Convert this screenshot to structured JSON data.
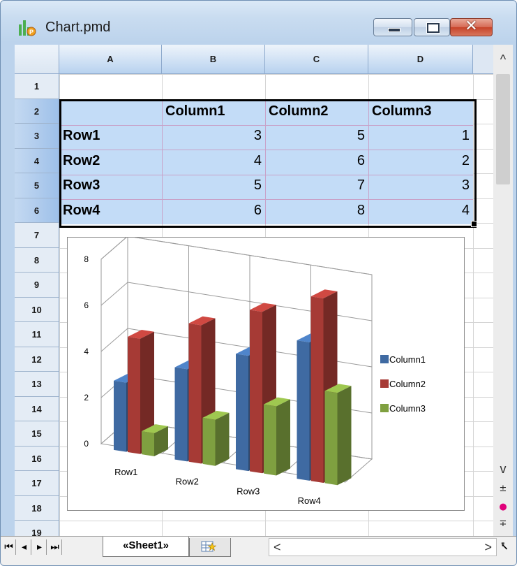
{
  "window": {
    "title": "Chart.pmd",
    "close_glyph": "✕"
  },
  "columns": [
    "A",
    "B",
    "C",
    "D"
  ],
  "rows": [
    "1",
    "2",
    "3",
    "4",
    "5",
    "6",
    "7",
    "8",
    "9",
    "10",
    "11",
    "12",
    "13",
    "14",
    "15",
    "16",
    "17",
    "18",
    "19"
  ],
  "table": {
    "headers": [
      "Column1",
      "Column2",
      "Column3"
    ],
    "row_labels": [
      "Row1",
      "Row2",
      "Row3",
      "Row4"
    ],
    "values": [
      [
        3,
        5,
        1
      ],
      [
        4,
        6,
        2
      ],
      [
        5,
        7,
        3
      ],
      [
        6,
        8,
        4
      ]
    ]
  },
  "chart_data": {
    "type": "bar",
    "categories": [
      "Row1",
      "Row2",
      "Row3",
      "Row4"
    ],
    "series": [
      {
        "name": "Column1",
        "values": [
          3,
          4,
          5,
          6
        ],
        "color": "#3f6aa2"
      },
      {
        "name": "Column2",
        "values": [
          5,
          6,
          7,
          8
        ],
        "color": "#a63a35"
      },
      {
        "name": "Column3",
        "values": [
          1,
          2,
          3,
          4
        ],
        "color": "#7fa040"
      }
    ],
    "ylim": [
      0,
      8
    ],
    "yticks": [
      "0",
      "2",
      "4",
      "6",
      "8"
    ],
    "legend": "right",
    "grid": true,
    "style": "3d-column"
  },
  "sheet_tabs": {
    "active": "«Sheet1»"
  },
  "scroll": {
    "up": "^",
    "down": "v",
    "left": "<",
    "right": ">"
  }
}
